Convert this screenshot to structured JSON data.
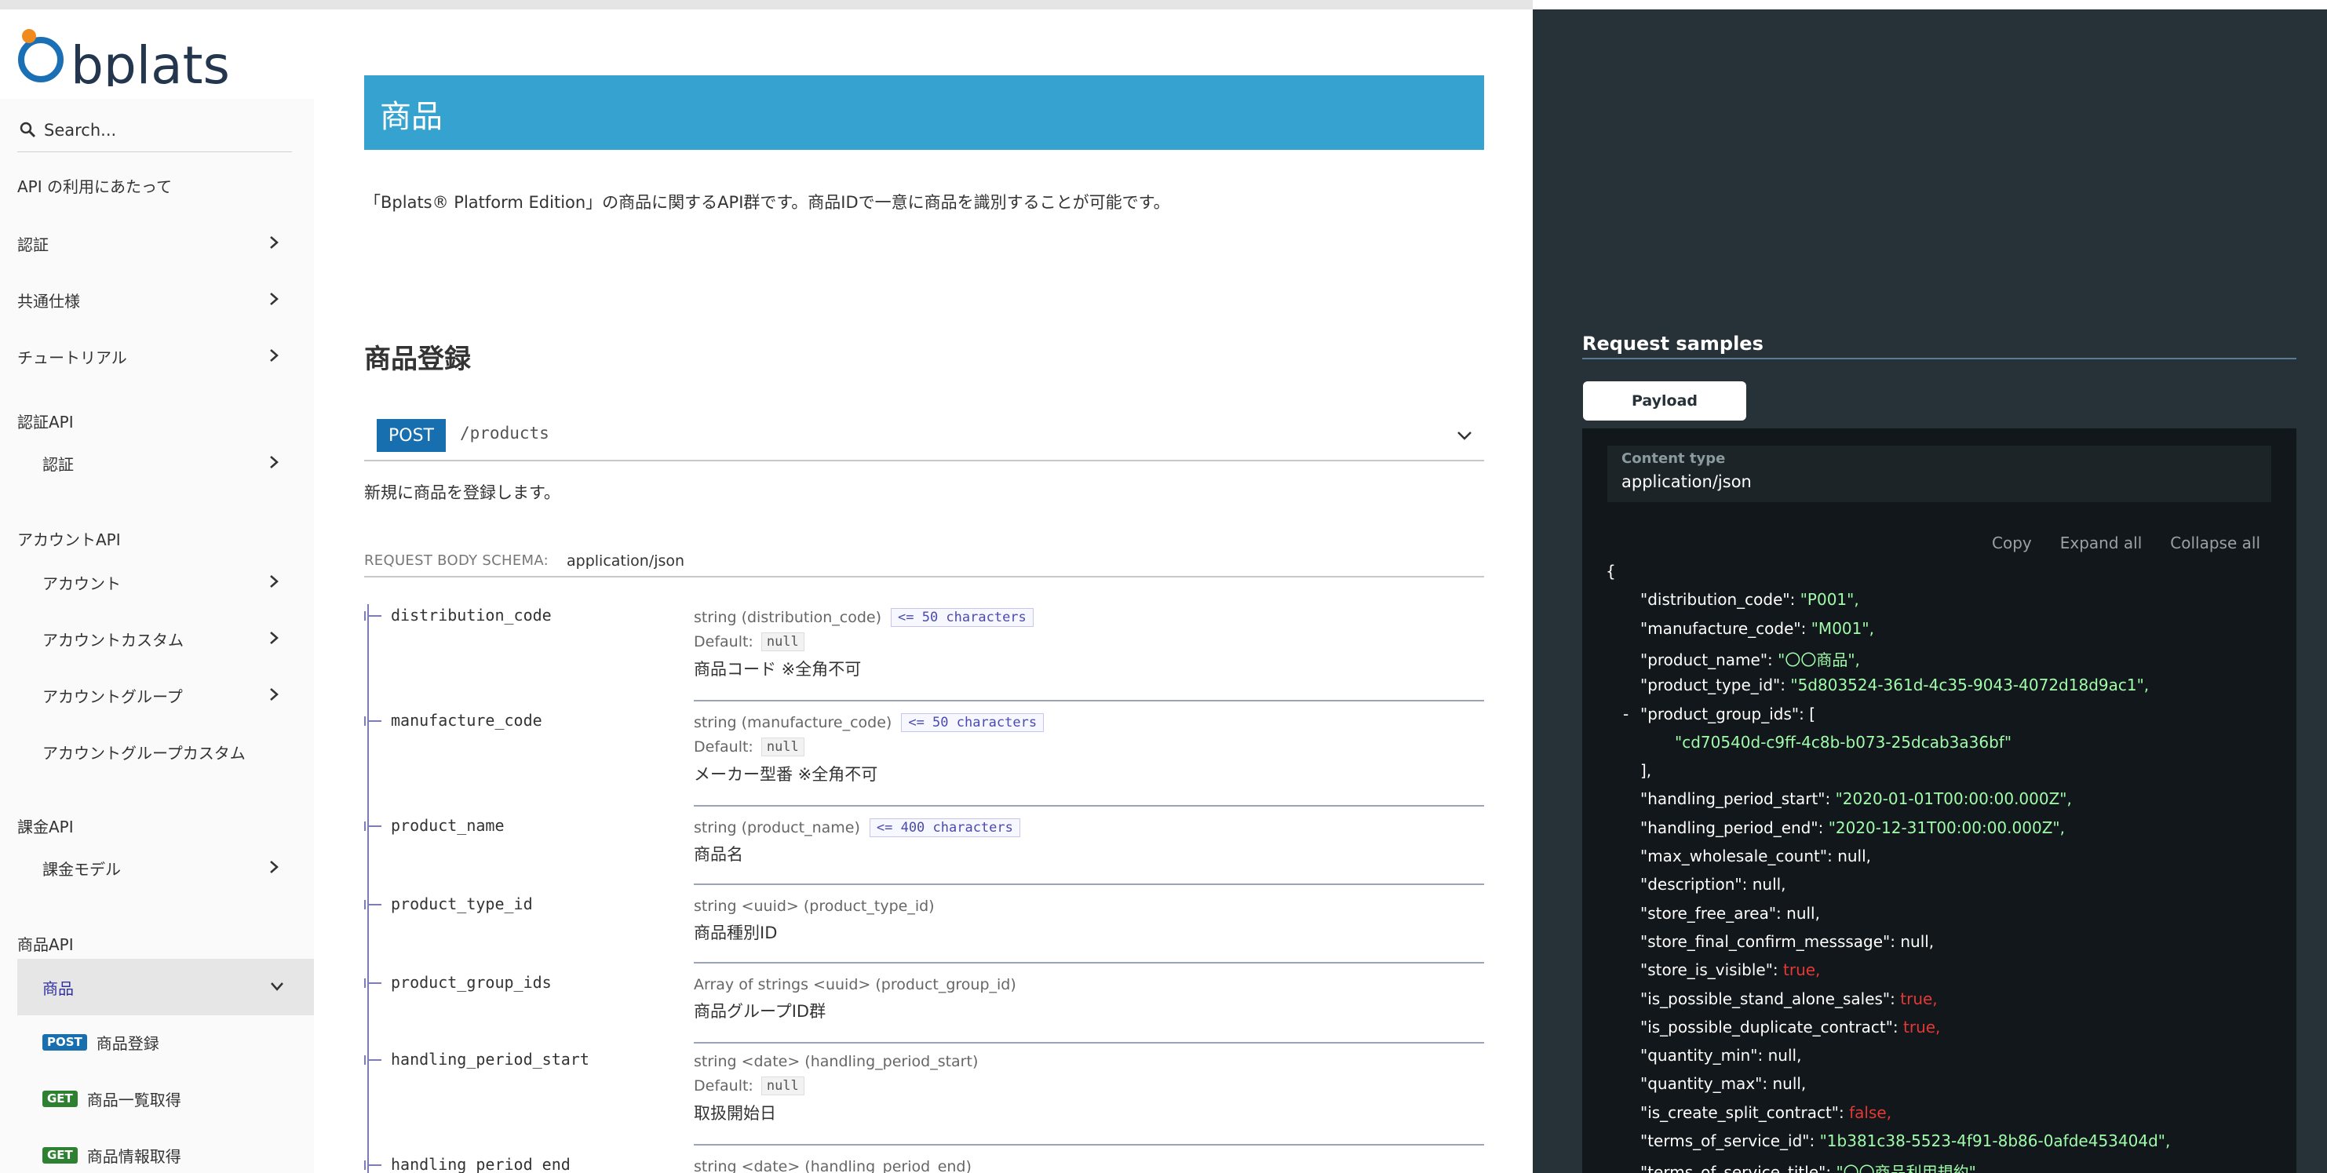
{
  "brand": {
    "logo_text": "bplats"
  },
  "search": {
    "placeholder": "Search..."
  },
  "sidebar": {
    "intro": "API の利用にあたって",
    "sections": [
      {
        "label": "認証"
      },
      {
        "label": "共通仕様"
      },
      {
        "label": "チュートリアル"
      }
    ],
    "groups": [
      {
        "heading": "認証API",
        "items": [
          {
            "label": "認証"
          }
        ]
      },
      {
        "heading": "アカウントAPI",
        "items": [
          {
            "label": "アカウント"
          },
          {
            "label": "アカウントカスタム"
          },
          {
            "label": "アカウントグループ"
          },
          {
            "label": "アカウントグループカスタム"
          }
        ]
      },
      {
        "heading": "課金API",
        "items": [
          {
            "label": "課金モデル"
          }
        ]
      },
      {
        "heading": "商品API",
        "items": [
          {
            "label": "商品"
          }
        ]
      }
    ],
    "operations": [
      {
        "method": "POST",
        "label": "商品登録"
      },
      {
        "method": "GET",
        "label": "商品一覧取得"
      },
      {
        "method": "GET",
        "label": "商品情報取得"
      }
    ]
  },
  "main": {
    "title": "商品",
    "description": "「Bplats® Platform Edition」の商品に関するAPI群です。商品IDで一意に商品を識別することが可能です。",
    "operation": {
      "title": "商品登録",
      "method": "POST",
      "path": "/products",
      "description": "新規に商品を登録します。",
      "schema_label": "REQUEST BODY SCHEMA:",
      "schema_type": "application/json",
      "default_label": "Default:",
      "properties": [
        {
          "name": "distribution_code",
          "type": "string (distribution_code)",
          "constraint": "<= 50 characters",
          "default": "null",
          "desc": "商品コード ※全角不可"
        },
        {
          "name": "manufacture_code",
          "type": "string (manufacture_code)",
          "constraint": "<= 50 characters",
          "default": "null",
          "desc": "メーカー型番 ※全角不可"
        },
        {
          "name": "product_name",
          "type": "string (product_name)",
          "constraint": "<= 400 characters",
          "desc": "商品名"
        },
        {
          "name": "product_type_id",
          "type": "string <uuid> (product_type_id)",
          "desc": "商品種別ID"
        },
        {
          "name": "product_group_ids",
          "type": "Array of strings <uuid> (product_group_id)",
          "desc": "商品グループID群"
        },
        {
          "name": "handling_period_start",
          "type": "string <date> (handling_period_start)",
          "default": "null",
          "desc": "取扱開始日"
        },
        {
          "name": "handling_period_end",
          "type": "string <date> (handling_period_end)"
        }
      ]
    }
  },
  "right_panel": {
    "title": "Request samples",
    "tab": "Payload",
    "content_type_label": "Content type",
    "content_type_value": "application/json",
    "actions": {
      "copy": "Copy",
      "expand": "Expand all",
      "collapse": "Collapse all"
    },
    "code_lines": [
      {
        "indent": 0,
        "key": "",
        "value": "{",
        "vtype": "p"
      },
      {
        "indent": 1,
        "key": "\"distribution_code\"",
        "value": "\"P001\",",
        "vtype": "s"
      },
      {
        "indent": 1,
        "key": "\"manufacture_code\"",
        "value": "\"M001\",",
        "vtype": "s"
      },
      {
        "indent": 1,
        "key": "\"product_name\"",
        "value": "\"〇〇商品\",",
        "vtype": "s"
      },
      {
        "indent": 1,
        "key": "\"product_type_id\"",
        "value": "\"5d803524-361d-4c35-9043-4072d18d9ac1\",",
        "vtype": "s"
      },
      {
        "indent": 1,
        "key": "\"product_group_ids\"",
        "value": "[",
        "vtype": "p",
        "collapse": "-"
      },
      {
        "indent": 2,
        "key": "",
        "value": "\"cd70540d-c9ff-4c8b-b073-25dcab3a36bf\"",
        "vtype": "s"
      },
      {
        "indent": 1,
        "key": "",
        "value": "],",
        "vtype": "p"
      },
      {
        "indent": 1,
        "key": "\"handling_period_start\"",
        "value": "\"2020-01-01T00:00:00.000Z\",",
        "vtype": "s"
      },
      {
        "indent": 1,
        "key": "\"handling_period_end\"",
        "value": "\"2020-12-31T00:00:00.000Z\",",
        "vtype": "s"
      },
      {
        "indent": 1,
        "key": "\"max_wholesale_count\"",
        "value": "null,",
        "vtype": "n"
      },
      {
        "indent": 1,
        "key": "\"description\"",
        "value": "null,",
        "vtype": "n"
      },
      {
        "indent": 1,
        "key": "\"store_free_area\"",
        "value": "null,",
        "vtype": "n"
      },
      {
        "indent": 1,
        "key": "\"store_final_confirm_messsage\"",
        "value": "null,",
        "vtype": "n"
      },
      {
        "indent": 1,
        "key": "\"store_is_visible\"",
        "value": "true,",
        "vtype": "b"
      },
      {
        "indent": 1,
        "key": "\"is_possible_stand_alone_sales\"",
        "value": "true,",
        "vtype": "b"
      },
      {
        "indent": 1,
        "key": "\"is_possible_duplicate_contract\"",
        "value": "true,",
        "vtype": "b"
      },
      {
        "indent": 1,
        "key": "\"quantity_min\"",
        "value": "null,",
        "vtype": "n"
      },
      {
        "indent": 1,
        "key": "\"quantity_max\"",
        "value": "null,",
        "vtype": "n"
      },
      {
        "indent": 1,
        "key": "\"is_create_split_contract\"",
        "value": "false,",
        "vtype": "b"
      },
      {
        "indent": 1,
        "key": "\"terms_of_service_id\"",
        "value": "\"1b381c38-5523-4f91-8b86-0afde453404d\",",
        "vtype": "s"
      },
      {
        "indent": 1,
        "key": "\"terms_of_service_title\"",
        "value": "\"〇〇商品利用規約\",",
        "vtype": "s"
      }
    ]
  },
  "colors": {
    "banner": "#36a2d0",
    "post": "#186faf",
    "get": "#2f8132",
    "right_panel_bg": "#263238",
    "code_string": "#a0fbaa",
    "code_bool": "#e53935",
    "active_nav_text": "#32329f"
  }
}
